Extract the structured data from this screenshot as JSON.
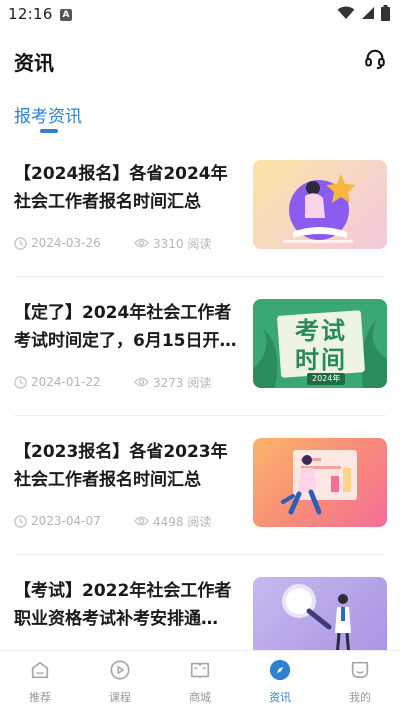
{
  "status_bar": {
    "time": "12:16",
    "notification_badge": "A"
  },
  "header": {
    "title": "资讯",
    "support_icon": "headset-icon"
  },
  "tabs": [
    {
      "label": "报考资讯",
      "active": true
    }
  ],
  "articles": [
    {
      "title": "【2024报名】各省2024年社会工作者报名时间汇总",
      "date": "2024-03-26",
      "views": "3310 阅读",
      "thumbnail": "reading-girl-illustration"
    },
    {
      "title": "【定了】2024年社会工作者考试时间定了，6月15日开…",
      "date": "2024-01-22",
      "views": "3273 阅读",
      "thumbnail": "exam-time-board-illustration",
      "thumb_text": "考试时间",
      "thumb_tag": "2024年"
    },
    {
      "title": "【2023报名】各省2023年社会工作者报名时间汇总",
      "date": "2023-04-07",
      "views": "4498 阅读",
      "thumbnail": "runner-chart-illustration"
    },
    {
      "title": "【考试】2022年社会工作者职业资格考试补考安排通…",
      "date": "",
      "views": "",
      "thumbnail": "magnifier-girl-illustration"
    }
  ],
  "bottom_nav": [
    {
      "label": "推荐",
      "icon": "home-icon",
      "active": false
    },
    {
      "label": "课程",
      "icon": "play-circle-icon",
      "active": false
    },
    {
      "label": "商城",
      "icon": "book-shop-icon",
      "active": false
    },
    {
      "label": "资讯",
      "icon": "compass-icon",
      "active": true
    },
    {
      "label": "我的",
      "icon": "profile-icon",
      "active": false
    }
  ],
  "colors": {
    "accent": "#2f80d1",
    "muted": "#b5b5b5",
    "nav_inactive": "#999999"
  }
}
